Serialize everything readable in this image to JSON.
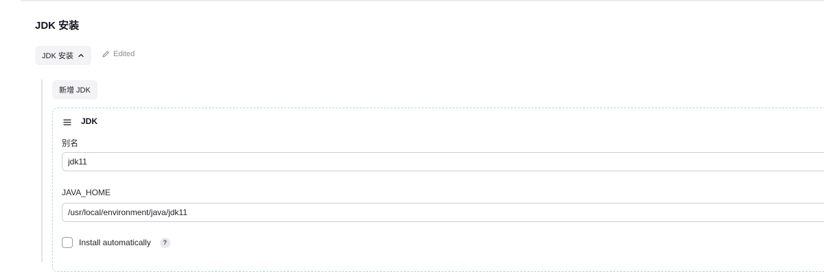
{
  "section": {
    "title": "JDK 安装"
  },
  "toggle": {
    "label": "JDK 安装",
    "icon": "chevron-up-icon"
  },
  "status": {
    "icon": "pencil-icon",
    "text": "Edited"
  },
  "add_button": {
    "label": "新增 JDK"
  },
  "jdk_entry": {
    "handle_icon": "drag-handle-icon",
    "title": "JDK",
    "alias": {
      "label": "别名",
      "value": "jdk11"
    },
    "java_home": {
      "label": "JAVA_HOME",
      "value": "/usr/local/environment/java/jdk11"
    },
    "install_automatically": {
      "label": "Install automatically",
      "checked": false,
      "help_icon": "help-icon",
      "help_text": "?"
    }
  },
  "colors": {
    "card_border": "#b7d6dc",
    "button_bg": "#f3f3f6",
    "muted_text": "#8a8a93"
  }
}
